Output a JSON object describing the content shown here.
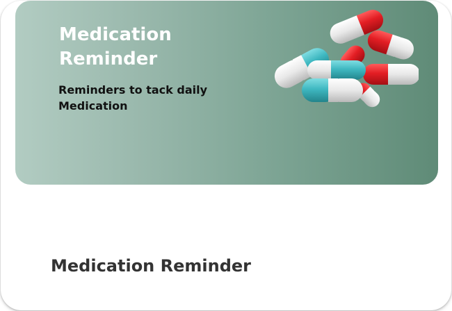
{
  "banner": {
    "title": "Medication Reminder",
    "subtitle": "Reminders to tack daily Medication",
    "gradient_start": "#b2ccc2",
    "gradient_end": "#5f8b77",
    "image": "medication-capsules-illustration"
  },
  "card": {
    "title": "Medication Reminder"
  },
  "colors": {
    "capsule_red": "#e31e24",
    "capsule_teal": "#3fb8c1",
    "capsule_white": "#e8e8e8"
  }
}
